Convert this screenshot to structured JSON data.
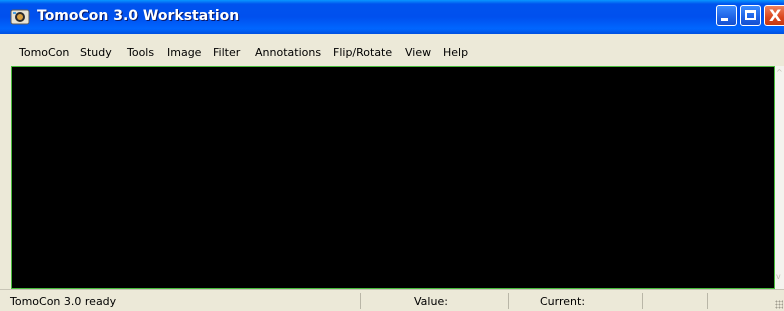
{
  "window": {
    "title": "TomoCon 3.0 Workstation",
    "icon": "tomocon-app-icon",
    "controls": {
      "minimize": "minimize-icon",
      "maximize": "maximize-icon",
      "close_glyph": "X"
    }
  },
  "menubar": {
    "items": [
      {
        "label": "TomoCon",
        "name": "menu-tomocon"
      },
      {
        "label": "Study",
        "name": "menu-study"
      },
      {
        "label": "Tools",
        "name": "menu-tools"
      },
      {
        "label": "Image",
        "name": "menu-image"
      },
      {
        "label": "Filter",
        "name": "menu-filter"
      },
      {
        "label": "Annotations",
        "name": "menu-annotations"
      },
      {
        "label": "Flip/Rotate",
        "name": "menu-flip-rotate"
      },
      {
        "label": "View",
        "name": "menu-view"
      },
      {
        "label": "Help",
        "name": "menu-help"
      }
    ]
  },
  "statusbar": {
    "message": "TomoCon 3.0 ready",
    "value_label": "Value:",
    "current_label": "Current:"
  },
  "colors": {
    "titlebar": "#0054e3",
    "viewport_background": "#000000",
    "viewport_border": "#48bb3c",
    "chrome": "#ece9d8"
  }
}
